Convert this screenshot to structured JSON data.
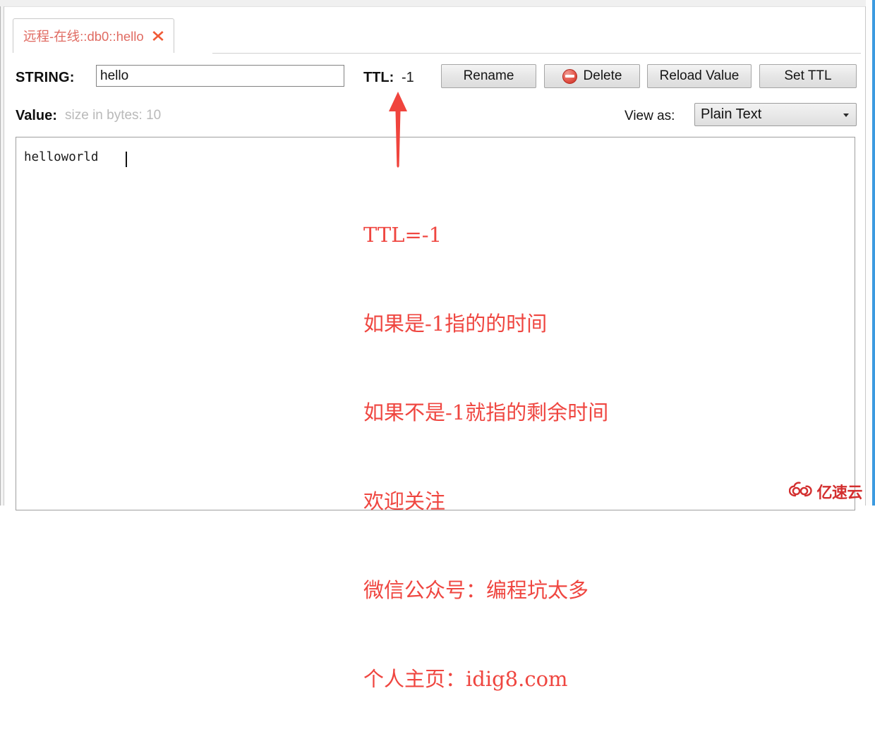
{
  "window": {
    "accent_border_color": "#3c9ae0",
    "background": "#ffffff"
  },
  "tabs": [
    {
      "label": "远程-在线::db0::hello",
      "color": "#e06b62",
      "close_icon": "close-x-icon",
      "active": true
    }
  ],
  "key_row": {
    "type_label": "STRING:",
    "key_name_value": "hello",
    "key_name_placeholder": "hello",
    "ttl_label": "TTL:",
    "ttl_value": "-1",
    "buttons": [
      {
        "label": "Rename",
        "icon": null
      },
      {
        "label": "Delete",
        "icon": "delete-circle-icon"
      },
      {
        "label": "Reload Value",
        "icon": null
      },
      {
        "label": "Set TTL",
        "icon": null
      }
    ]
  },
  "value_row": {
    "value_label": "Value:",
    "size_text": "size in bytes: 10",
    "view_as_label": "View as:",
    "view_as_selected": "Plain Text",
    "view_as_options": [
      "Plain Text"
    ]
  },
  "value_editor": {
    "content": "helloworld "
  },
  "annotation": {
    "color": "#ef4640",
    "arrow": "up-arrow",
    "lines": [
      "TTL=-1",
      "如果是-1指的的时间",
      "如果不是-1就指的剩余时间",
      "欢迎关注",
      "微信公众号：编程坑太多",
      "个人主页：idig8.com"
    ]
  },
  "watermark": {
    "text": "亿速云",
    "icon": "cloud-logo-icon",
    "color": "#d32f2f"
  }
}
